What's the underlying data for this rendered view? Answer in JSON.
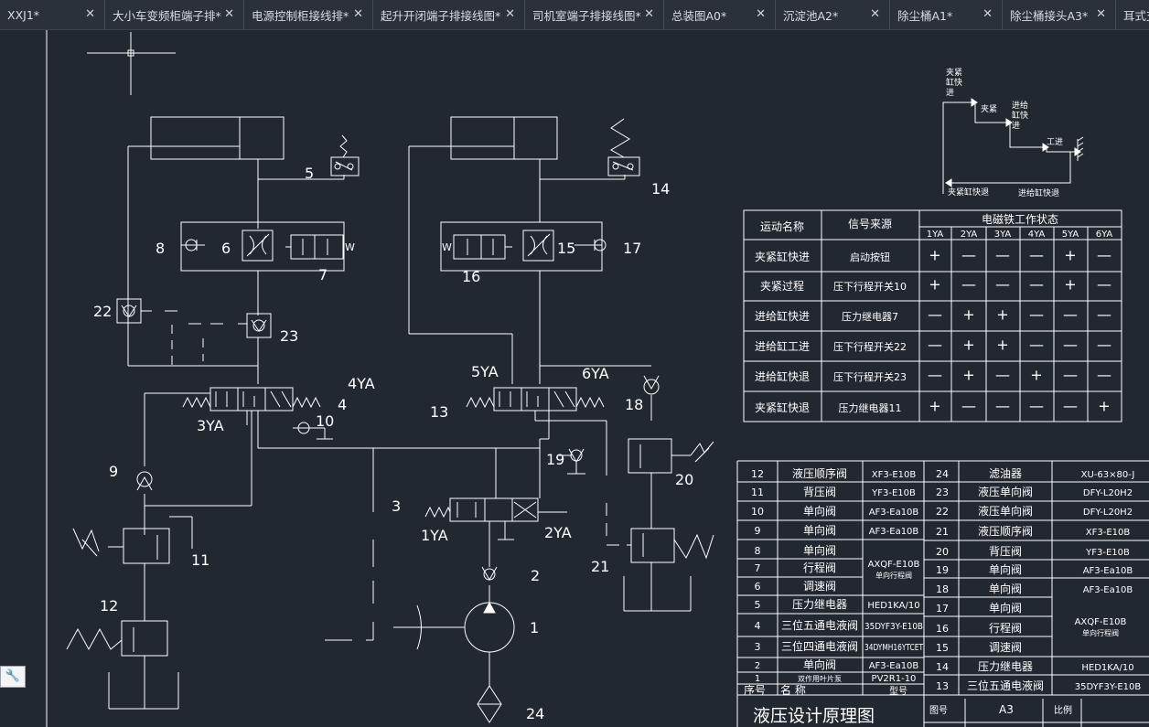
{
  "tabs": [
    {
      "label": "XXJ1*"
    },
    {
      "label": "大小车变频柜端子排*"
    },
    {
      "label": "电源控制柜接线排*"
    },
    {
      "label": "起升开闭端子排接线图*"
    },
    {
      "label": "司机室端子排接线图*"
    },
    {
      "label": "总装图A0*"
    },
    {
      "label": "沉淀池A2*"
    },
    {
      "label": "除尘桶A1*"
    },
    {
      "label": "除尘桶接头A3*"
    },
    {
      "label": "耳式支"
    }
  ],
  "close_glyph": "✕",
  "colors": {
    "background": "#212830",
    "line": "#ffffff",
    "tabbar": "#2b313b"
  },
  "diagram_labels": {
    "n5": "5",
    "n14": "14",
    "n8": "8",
    "n6": "6",
    "n7": "7",
    "n16": "16",
    "n15": "15",
    "n17": "17",
    "n22": "22",
    "n23": "23",
    "ya4": "4YA",
    "ya5": "5YA",
    "ya6": "6YA",
    "ya3": "3YA",
    "n4": "4",
    "n10": "10",
    "n13": "13",
    "n18": "18",
    "n19": "19",
    "n20": "20",
    "n9": "9",
    "n3": "3",
    "ya1": "1YA",
    "ya2": "2YA",
    "n11": "11",
    "n2": "2",
    "n21": "21",
    "n12": "12",
    "n1": "1",
    "n24": "24",
    "w1": "W",
    "w2": "W"
  },
  "cycle_diagram": {
    "a1": "夹紧",
    "a2": "缸快",
    "a3": "进",
    "b1": "夹紧",
    "c1": "进给",
    "c2": "缸快",
    "c3": "进",
    "d1": "工进",
    "e1": "夹紧缸快退",
    "e2": "进给缸快退"
  },
  "solenoid_table": {
    "col_motion": "运动名称",
    "col_signal": "信号来源",
    "col_state": "电磁铁工作状态",
    "ya_headers": [
      "1YA",
      "2YA",
      "3YA",
      "4YA",
      "5YA",
      "6YA"
    ],
    "rows": [
      {
        "motion": "夹紧缸快进",
        "signal": "启动按钮",
        "states": [
          "+",
          "—",
          "—",
          "—",
          "+",
          "—"
        ]
      },
      {
        "motion": "夹紧过程",
        "signal": "压下行程开关10",
        "states": [
          "+",
          "—",
          "—",
          "—",
          "+",
          "—"
        ]
      },
      {
        "motion": "进给缸快进",
        "signal": "压力继电器7",
        "states": [
          "—",
          "+",
          "+",
          "—",
          "—",
          "—"
        ]
      },
      {
        "motion": "进给缸工进",
        "signal": "压下行程开关22",
        "states": [
          "—",
          "+",
          "+",
          "—",
          "—",
          "—"
        ]
      },
      {
        "motion": "进给缸快退",
        "signal": "压下行程开关23",
        "states": [
          "—",
          "+",
          "—",
          "+",
          "—",
          "—"
        ]
      },
      {
        "motion": "夹紧缸快退",
        "signal": "压力继电器11",
        "states": [
          "+",
          "—",
          "—",
          "—",
          "—",
          "+"
        ]
      }
    ]
  },
  "parts_left": [
    {
      "no": "12",
      "name": "液压顺序阀",
      "model": "XF3-E10B"
    },
    {
      "no": "11",
      "name": "背压阀",
      "model": "YF3-E10B"
    },
    {
      "no": "10",
      "name": "单向阀",
      "model": "AF3-Ea10B"
    },
    {
      "no": "9",
      "name": "单向阀",
      "model": "AF3-Ea10B"
    },
    {
      "no": "8",
      "name": "单向阀",
      "model": ""
    },
    {
      "no": "7",
      "name": "行程阀",
      "model": ""
    },
    {
      "no": "6",
      "name": "调速阀",
      "model": ""
    },
    {
      "no": "5",
      "name": "压力继电器",
      "model": "HED1KA/10"
    },
    {
      "no": "4",
      "name": "三位五通电液阀",
      "model": "35DYF3Y-E10B"
    },
    {
      "no": "3",
      "name": "三位四通电液阀",
      "model": "34DYMH16YTCET"
    },
    {
      "no": "2",
      "name": "单向阀",
      "model": "AF3-Ea10B"
    },
    {
      "no": "1",
      "name": "双作用叶片泵",
      "model": "PV2R1-10"
    }
  ],
  "parts_left_merged": {
    "line1": "AXQF-E10B",
    "line2": "单向行程阀"
  },
  "parts_header": {
    "no": "序号",
    "name": "名 称",
    "model": "型号"
  },
  "parts_right": [
    {
      "no": "24",
      "name": "滤油器",
      "model": "XU-63×80-J"
    },
    {
      "no": "23",
      "name": "液压单向阀",
      "model": "DFY-L20H2"
    },
    {
      "no": "22",
      "name": "液压单向阀",
      "model": "DFY-L20H2"
    },
    {
      "no": "21",
      "name": "液压顺序阀",
      "model": "XF3-E10B"
    },
    {
      "no": "20",
      "name": "背压阀",
      "model": "YF3-E10B"
    },
    {
      "no": "19",
      "name": "单向阀",
      "model": "AF3-Ea10B"
    },
    {
      "no": "18",
      "name": "单向阀",
      "model": "AF3-Ea10B"
    },
    {
      "no": "17",
      "name": "单向阀",
      "model": ""
    },
    {
      "no": "16",
      "name": "行程阀",
      "model": ""
    },
    {
      "no": "15",
      "name": "调速阀",
      "model": ""
    },
    {
      "no": "14",
      "name": "压力继电器",
      "model": "HED1KA/10"
    },
    {
      "no": "13",
      "name": "三位五通电液阀",
      "model": "35DYF3Y-E10B"
    }
  ],
  "parts_right_merged": {
    "line1": "AXQF-E10B",
    "line2": "单向行程阀"
  },
  "title_block": {
    "title": "液压设计原理图",
    "label_no": "图号",
    "value_no": "A3",
    "label_scale": "比例"
  },
  "wrench_glyph": "🔧"
}
